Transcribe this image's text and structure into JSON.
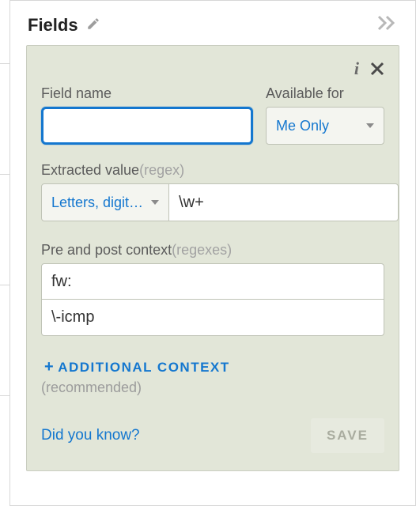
{
  "header": {
    "title": "Fields"
  },
  "card": {
    "field_name": {
      "label": "Field name",
      "value": ""
    },
    "available_for": {
      "label": "Available for",
      "selected": "Me Only"
    },
    "extracted": {
      "label": "Extracted value",
      "hint": "(regex)",
      "preset": "Letters, digit…",
      "regex": "\\w+"
    },
    "context": {
      "label": "Pre and post context",
      "hint": "(regexes)",
      "pre": "fw:",
      "post": "\\-icmp"
    },
    "additional": {
      "label": "Additional Context",
      "recommended": "(recommended)"
    },
    "footer": {
      "dyk": "Did you know?",
      "save": "SAVE"
    }
  }
}
